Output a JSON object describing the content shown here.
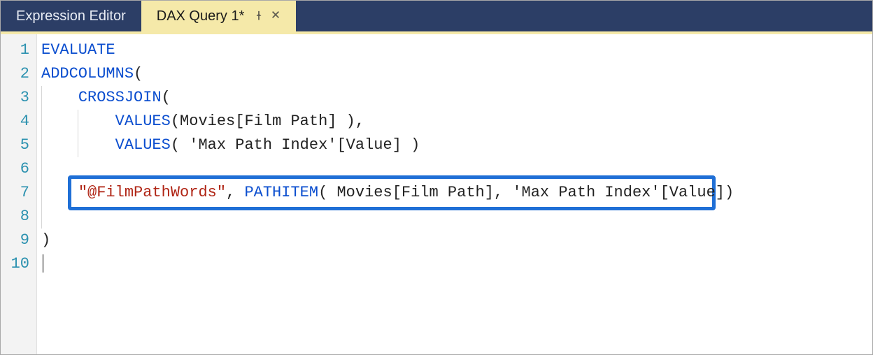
{
  "tabs": {
    "inactive_label": "Expression Editor",
    "active_label": "DAX Query 1*"
  },
  "gutter": {
    "lines": [
      "1",
      "2",
      "3",
      "4",
      "5",
      "6",
      "7",
      "8",
      "9",
      "10"
    ]
  },
  "code": {
    "l1_kw": "EVALUATE",
    "l2_fn": "ADDCOLUMNS",
    "l2_pn": "(",
    "l3_fn": "CROSSJOIN",
    "l3_pn": "(",
    "l4_fn": "VALUES",
    "l4_pn_open": "(",
    "l4_arg": "Movies[Film Path]",
    "l4_pn_close": " ),",
    "l5_fn": "VALUES",
    "l5_pn_open": "( ",
    "l5_arg": "'Max Path Index'[Value]",
    "l5_pn_close": " )",
    "l6_pn": ")",
    "l7_str": "\"@FilmPathWords\"",
    "l7_sep": ", ",
    "l7_fn": "PATHITEM",
    "l7_pn_open": "( ",
    "l7_arg1": "Movies[Film Path]",
    "l7_comma": ", ",
    "l7_arg2": "'Max Path Index'[Value]",
    "l7_pn_close": ")",
    "l9_pn": ")"
  }
}
